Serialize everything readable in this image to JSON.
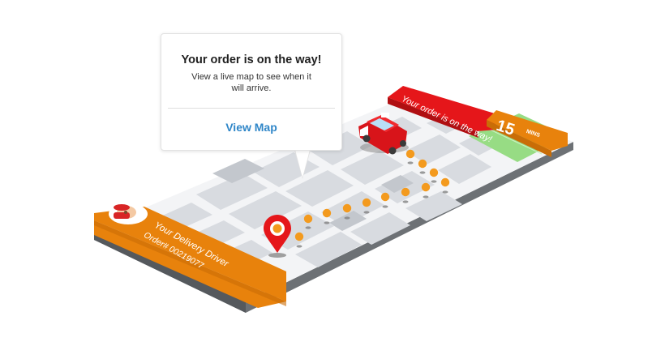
{
  "popup": {
    "title": "Your order is on the way!",
    "body": "View a live map to see when it will arrive.",
    "link": "View Map"
  },
  "banner": {
    "text": "Your order is on the way!",
    "eta_value": "15",
    "eta_unit": "MINS"
  },
  "driver": {
    "name": "Your Delivery Driver",
    "order": "Order# 00219077"
  },
  "icons": [
    "delivery-car-icon",
    "location-pin-icon",
    "driver-avatar-icon"
  ],
  "colors": {
    "orange": "#e8820c",
    "red": "#e5161a",
    "route_dot": "#f39a1e",
    "map_block": "#d6d9de",
    "map_road": "#f4f5f7",
    "park": "#98dd85",
    "platform_side": "#6f7377",
    "link": "#2f86c8"
  }
}
